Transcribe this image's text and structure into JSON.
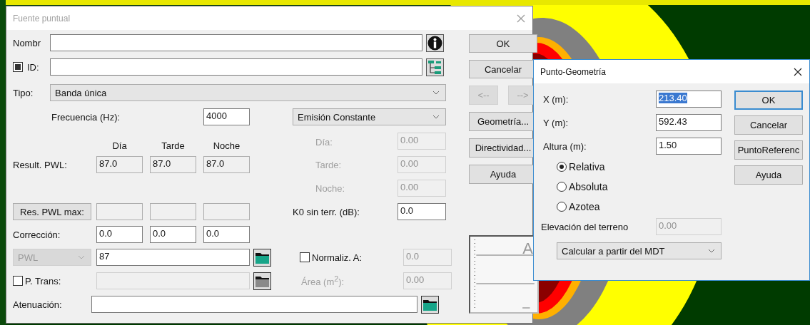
{
  "fuente_puntual": {
    "title": "Fuente puntual",
    "nombre": {
      "label": "Nombr"
    },
    "id": {
      "label": "ID:",
      "checked": true
    },
    "tipo": {
      "label": "Tipo:",
      "value": "Banda única"
    },
    "frecuencia": {
      "label": "Frecuencia (Hz):",
      "value": "4000"
    },
    "emision": {
      "value": "Emisión Constante"
    },
    "period_headers": [
      "Día",
      "Tarde",
      "Noche"
    ],
    "result_pwl": {
      "label": "Result. PWL:",
      "values": [
        "87.0",
        "87.0",
        "87.0"
      ]
    },
    "emission_periods": [
      {
        "label": "Día:",
        "value": "0.00",
        "disabled": true
      },
      {
        "label": "Tarde:",
        "value": "0.00",
        "disabled": true
      },
      {
        "label": "Noche:",
        "value": "0.00",
        "disabled": true
      }
    ],
    "res_pwl_max": {
      "label": "Res. PWL max:"
    },
    "k0": {
      "label": "K0 sin terr. (dB):",
      "value": "0.0"
    },
    "correccion": {
      "label": "Corrección:",
      "values": [
        "0.0",
        "0.0",
        "0.0"
      ]
    },
    "pwl": {
      "select": "PWL",
      "disabled": true,
      "value": "87"
    },
    "normaliz": {
      "label": "Normaliz. A:",
      "checked": false,
      "value": "0.0"
    },
    "p_trans": {
      "label": "P. Trans:",
      "checked": false
    },
    "area": {
      "label": "Área (m$^{2}$):",
      "value": "0.00",
      "disabled": true
    },
    "atenuacion": {
      "label": "Atenuación:"
    },
    "buttons": [
      {
        "label": "OK",
        "disabled": false
      },
      {
        "label": "Cancelar",
        "disabled": false
      }
    ],
    "nav_buttons": [
      {
        "label": "<--",
        "disabled": true
      },
      {
        "label": "-->",
        "disabled": true
      }
    ],
    "more_buttons": [
      {
        "label": "Geometría...",
        "disabled": false
      },
      {
        "label": "Directividad...",
        "disabled": false
      },
      {
        "label": "Ayuda",
        "disabled": false
      }
    ],
    "preview": {
      "label": "A"
    }
  },
  "punto_geometria": {
    "title": "Punto-Geometría",
    "fields": [
      {
        "label": "X (m):",
        "value": "213.40",
        "selected": true
      },
      {
        "label": "Y (m):",
        "value": "592.43",
        "selected": false
      },
      {
        "label": "Altura (m):",
        "value": "1.50",
        "selected": false
      }
    ],
    "buttons": [
      {
        "label": "OK",
        "focused": true
      },
      {
        "label": "Cancelar",
        "focused": false
      },
      {
        "label": "PuntoReferenc",
        "focused": false
      },
      {
        "label": "Ayuda",
        "focused": false
      }
    ],
    "radios": [
      {
        "label": "Relativa",
        "selected": true
      },
      {
        "label": "Absoluta",
        "selected": false
      },
      {
        "label": "Azotea",
        "selected": false
      }
    ],
    "elevacion": {
      "label": "Elevación del terreno",
      "value": "0.00",
      "disabled": true
    },
    "calcular": {
      "value": "Calcular a partir del MDT"
    }
  }
}
